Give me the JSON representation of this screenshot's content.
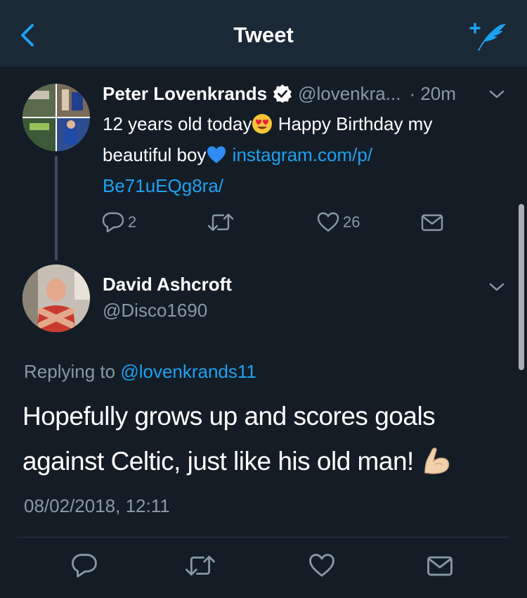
{
  "header": {
    "title": "Tweet"
  },
  "original_tweet": {
    "author_name": "Peter Lovenkrands",
    "author_handle": "@lovenkra...",
    "time": "· 20m",
    "text_part1": "12 years old today",
    "text_part2": " Happy Birthday my beautiful boy",
    "link_text": " instagram.com/p/ Be71uEQg8ra/",
    "actions": {
      "reply_count": "2",
      "retweet_count": "",
      "like_count": "26"
    }
  },
  "reply_tweet": {
    "author_name": "David Ashcroft",
    "author_handle": "@Disco1690",
    "replying_label": "Replying to ",
    "replying_handle": "@lovenkrands11",
    "text": "Hopefully grows up and scores goals against Celtic, just like his old man! ",
    "timestamp": "08/02/2018, 12:11"
  },
  "colors": {
    "background": "#141d26",
    "header": "#1b2836",
    "accent": "#1da1f2",
    "muted": "#8899a6"
  },
  "icons": {
    "back": "chevron-left-icon",
    "compose": "compose-quill-icon",
    "verified": "verified-badge-icon",
    "reply": "reply-bubble-icon",
    "retweet": "retweet-icon",
    "like": "heart-icon",
    "message": "envelope-icon"
  }
}
